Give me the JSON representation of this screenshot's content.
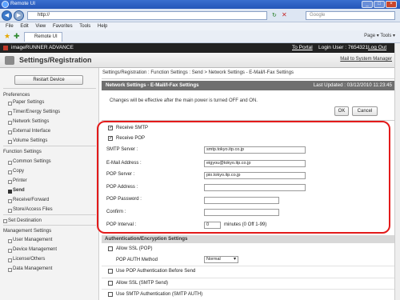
{
  "window": {
    "title": "Remote UI",
    "minimize": "_",
    "maximize": "□",
    "close": "×"
  },
  "browser": {
    "url": "http://",
    "search_placeholder": "Google",
    "menu": [
      "File",
      "Edit",
      "View",
      "Favorites",
      "Tools",
      "Help"
    ],
    "tab_title": "Remote UI",
    "tools": "Page ▾   Tools ▾"
  },
  "header": {
    "product": "imageRUNNER ADVANCE",
    "to_portal": "To Portal",
    "login_user": "Login User : 7654321",
    "logout": "Log Out",
    "page_title": "Settings/Registration",
    "mail_link": "Mail to System Manager"
  },
  "sidebar": {
    "restart": "Restart Device",
    "preferences": "Preferences",
    "pref_items": [
      "Paper Settings",
      "Timer/Energy Settings",
      "Network Settings",
      "External Interface",
      "Volume Settings"
    ],
    "function_settings": "Function Settings",
    "func_items": [
      "Common Settings",
      "Copy",
      "Printer",
      "Send",
      "Receive/Forward",
      "Store/Access Files"
    ],
    "set_destination": "Set Destination",
    "management_settings": "Management Settings",
    "mgmt_items": [
      "User Management",
      "Device Management",
      "License/Others",
      "Data Management"
    ]
  },
  "main": {
    "breadcrumb": "Settings/Registration : Function Settings : Send > Network Settings - E-Mail/I-Fax Settings",
    "panel_title": "Network Settings - E-Mail/I-Fax Settings",
    "last_updated": "Last Updated : 03/12/2010 11:23:45",
    "notice": "Changes will be effective after the main power is turned OFF and ON.",
    "ok": "OK",
    "cancel": "Cancel",
    "receive_smtp": "Receive SMTP",
    "receive_pop": "Receive POP",
    "smtp_server_label": "SMTP Server :",
    "smtp_server": "smtp.tokyo.itp.co.jp",
    "email_label": "E-Mail Address :",
    "email": "eigyou@tokyo.itp.co.jp",
    "pop_server_label": "POP Server :",
    "pop_server": "pio.tokyo.itp.co.jp",
    "pop_address_label": "POP Address :",
    "pop_address": "",
    "pop_password_label": "POP Password :",
    "confirm_label": "Confirm :",
    "pop_interval_label": "POP Interval :",
    "pop_interval": "0",
    "minutes_hint": "minutes (0 Off 1-99)",
    "auth_header": "Authentication/Encryption Settings",
    "allow_ssl_pop": "Allow SSL (POP)",
    "pop_auth_method": "POP AUTH Method",
    "pop_auth_value": "Normal",
    "pop_before_send": "Use POP Authentication Before Send",
    "allow_ssl_smtp": "Allow SSL (SMTP Send)",
    "smtp_auth": "Use SMTP Authentication (SMTP AUTH)"
  },
  "colors": {
    "highlight": "#e31b1b",
    "header_dark": "#222222",
    "panel_header": "#6f6f6f"
  }
}
